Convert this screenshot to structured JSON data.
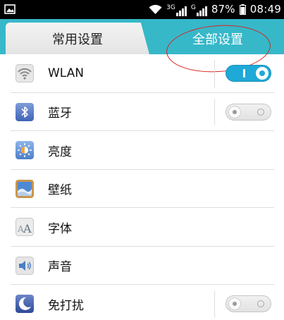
{
  "status_bar": {
    "network_type_1": "3G",
    "network_type_2": "G",
    "battery": "87%",
    "time": "08:49"
  },
  "tabs": [
    {
      "label": "常用设置",
      "selected": true
    },
    {
      "label": "全部设置",
      "selected": false
    }
  ],
  "settings": [
    {
      "label": "WLAN",
      "icon": "wifi-icon",
      "toggle": "on"
    },
    {
      "label": "蓝牙",
      "icon": "bluetooth-icon",
      "toggle": "off"
    },
    {
      "label": "亮度",
      "icon": "brightness-icon",
      "toggle": null
    },
    {
      "label": "壁纸",
      "icon": "wallpaper-icon",
      "toggle": null
    },
    {
      "label": "字体",
      "icon": "font-icon",
      "toggle": null
    },
    {
      "label": "声音",
      "icon": "sound-icon",
      "toggle": null
    },
    {
      "label": "免打扰",
      "icon": "do-not-disturb-icon",
      "toggle": "off"
    }
  ],
  "colors": {
    "accent": "#36b8c9",
    "toggle_on": "#1ea9d7",
    "annotation": "#d9251f"
  }
}
